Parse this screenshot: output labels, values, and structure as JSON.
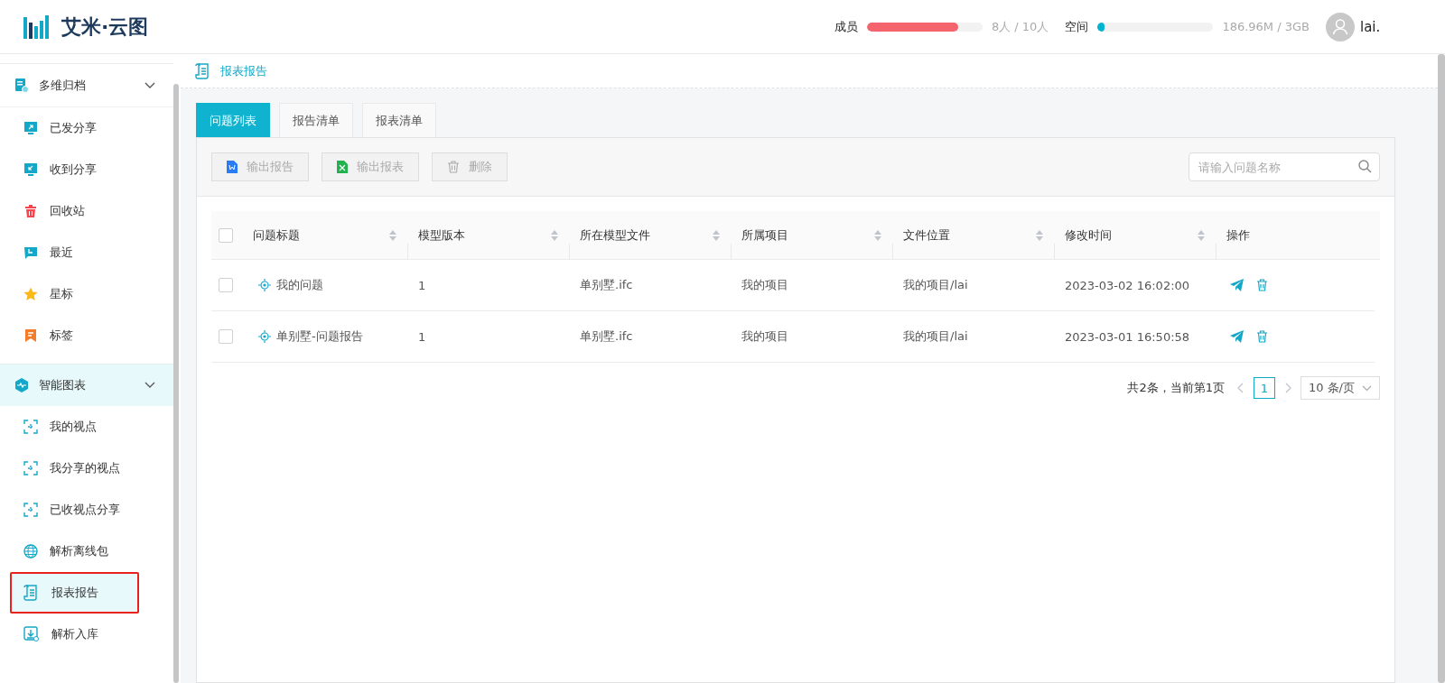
{
  "header": {
    "logo_text": "艾米·云图",
    "quotas": [
      {
        "label": "成员",
        "level": 0.79,
        "reading": "8人 / 10人",
        "color": "#f5646c"
      },
      {
        "label": "空间",
        "level": 0.06,
        "reading": "186.96M / 3GB",
        "color": "#00b4d0"
      }
    ],
    "user": "lai."
  },
  "sidebar": {
    "groups": [
      {
        "label": "多维归档",
        "kind": "archive",
        "expanded": true,
        "children": [
          {
            "label": "已发分享",
            "kind": "share-out",
            "selected": false
          },
          {
            "label": "收到分享",
            "kind": "share-in",
            "selected": false
          },
          {
            "label": "回收站",
            "kind": "trash",
            "selected": false
          },
          {
            "label": "最近",
            "kind": "recent",
            "selected": false
          },
          {
            "label": "星标",
            "kind": "star",
            "selected": false
          },
          {
            "label": "标签",
            "kind": "tag",
            "selected": false
          }
        ]
      },
      {
        "label": "智能图表",
        "kind": "chart",
        "expanded": true,
        "children": [
          {
            "label": "我的视点",
            "kind": "viewpoint",
            "selected": false
          },
          {
            "label": "我分享的视点",
            "kind": "viewpoint",
            "selected": false
          },
          {
            "label": "已收视点分享",
            "kind": "viewpoint",
            "selected": false
          },
          {
            "label": "解析离线包",
            "kind": "globe",
            "selected": false
          },
          {
            "label": "报表报告",
            "kind": "report",
            "selected": true
          },
          {
            "label": "解析入库",
            "kind": "import",
            "selected": false
          }
        ]
      }
    ]
  },
  "breadcrumb": "报表报告",
  "tabs": [
    {
      "label": "问题列表",
      "selected": true
    },
    {
      "label": "报告清单",
      "selected": false
    },
    {
      "label": "报表清单",
      "selected": false
    }
  ],
  "toolbar": {
    "buttons": [
      {
        "label": "输出报告",
        "kind": "word",
        "disabled": true
      },
      {
        "label": "输出报表",
        "kind": "excel",
        "disabled": true
      },
      {
        "label": "删除",
        "kind": "delete",
        "disabled": true
      }
    ],
    "search": {
      "placeholder": "请输入问题名称"
    }
  },
  "table": {
    "all_checked": false,
    "columns": [
      {
        "label": "问题标题",
        "sortable": true
      },
      {
        "label": "模型版本",
        "sortable": true
      },
      {
        "label": "所在模型文件",
        "sortable": true
      },
      {
        "label": "所属项目",
        "sortable": true
      },
      {
        "label": "文件位置",
        "sortable": true
      },
      {
        "label": "修改时间",
        "sortable": true
      },
      {
        "label": "操作",
        "sortable": false
      }
    ],
    "rows": [
      {
        "checked": false,
        "cells": [
          "我的问题",
          "1",
          "单别墅.ifc",
          "我的项目",
          "我的项目/lai",
          "2023-03-02 16:02:00"
        ]
      },
      {
        "checked": false,
        "cells": [
          "单别墅-问题报告",
          "1",
          "单别墅.ifc",
          "我的项目",
          "我的项目/lai",
          "2023-03-01 16:50:58"
        ]
      }
    ]
  },
  "pagination": {
    "summary": "共2条，当前第1页",
    "pages": [
      {
        "label": "1",
        "selected": true
      }
    ],
    "page_size": "10 条/页"
  }
}
